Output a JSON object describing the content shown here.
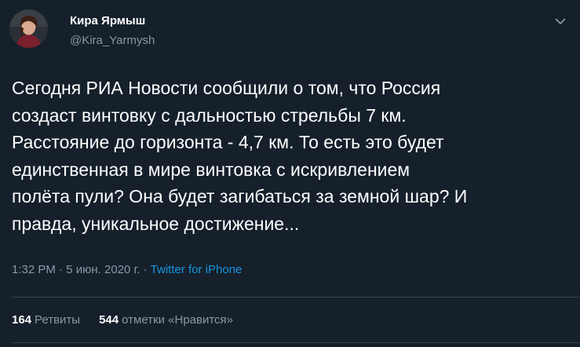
{
  "author": {
    "display_name": "Кира Ярмыш",
    "handle": "@Kira_Yarmysh"
  },
  "tweet": {
    "text": "Сегодня РИА Новости сообщили о том, что Россия\nсоздаст винтовку с дальностью стрельбы 7 км.\nРасстояние до горизонта - 4,7 км. То есть это будет\nединственная в мире винтовка с искривлением\nполёта пули? Она будет загибаться за земной шар? И\nправда, уникальное достижение...",
    "time": "1:32 PM",
    "date": "5 июн. 2020 г.",
    "separator": "·",
    "source": "Twitter for iPhone"
  },
  "stats": {
    "retweets_count": "164",
    "retweets_label": "Ретвиты",
    "likes_count": "544",
    "likes_label": "отметки «Нравится»"
  },
  "icons": {
    "menu": "chevron-down-icon"
  },
  "colors": {
    "background": "#15202b",
    "text": "#ffffff",
    "secondary": "#8899a6",
    "link": "#1b95e0",
    "divider": "#38444d"
  }
}
